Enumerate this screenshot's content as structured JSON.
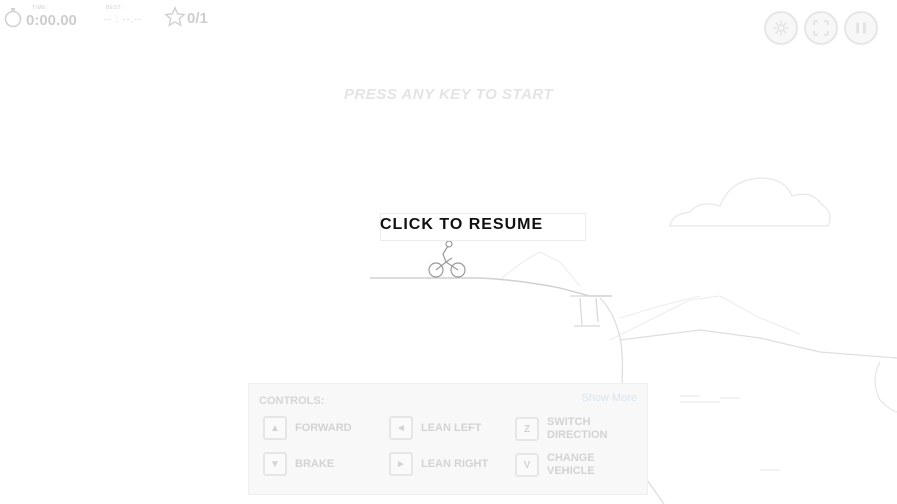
{
  "hud": {
    "time_label": "TIME:",
    "time_value": "0:00.00",
    "best_label": "BEST:",
    "best_value": "-- : --.--",
    "stars": "0/1"
  },
  "top_buttons": {
    "settings_icon": "gear-icon",
    "fullscreen_icon": "fullscreen-icon",
    "pause_icon": "pause-icon"
  },
  "messages": {
    "press_start": "PRESS ANY KEY TO START",
    "click_resume": "CLICK TO RESUME"
  },
  "controls": {
    "title": "CONTROLS:",
    "show_more": "Show More",
    "items": [
      {
        "key": "▲",
        "label": "FORWARD"
      },
      {
        "key": "◄",
        "label": "LEAN LEFT"
      },
      {
        "key": "Z",
        "label": "SWITCH\nDIRECTION"
      },
      {
        "key": "▼",
        "label": "BRAKE"
      },
      {
        "key": "►",
        "label": "LEAN RIGHT"
      },
      {
        "key": "V",
        "label": "CHANGE\nVEHICLE"
      }
    ]
  },
  "colors": {
    "background": "#ffffff",
    "faded_ui": "#cfcfcf",
    "resume_text": "#111111",
    "show_more_link": "#d9e4f2"
  }
}
